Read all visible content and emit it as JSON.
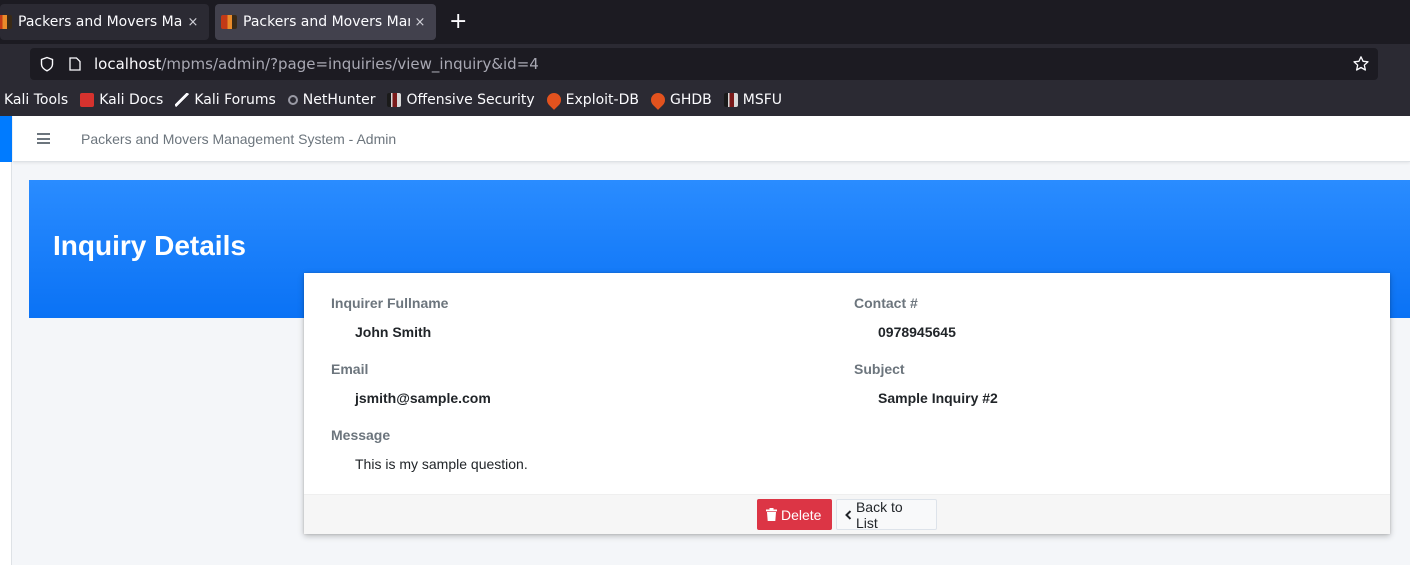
{
  "browser": {
    "tabs": [
      {
        "title": "Packers and Movers Management System",
        "close": "×"
      },
      {
        "title": "Packers and Movers Management System",
        "close": "×"
      }
    ],
    "new_tab": "+",
    "url": {
      "host": "localhost",
      "path": "/mpms/admin/?page=inquiries/view_inquiry&id=4"
    },
    "bookmarks": [
      {
        "label": "Kali Tools",
        "icon": "kali-tools-icon"
      },
      {
        "label": "Kali Docs",
        "icon": "kali-docs-icon"
      },
      {
        "label": "Kali Forums",
        "icon": "kali-forums-icon"
      },
      {
        "label": "NetHunter",
        "icon": "nethunter-icon"
      },
      {
        "label": "Offensive Security",
        "icon": "offensive-security-icon"
      },
      {
        "label": "Exploit-DB",
        "icon": "exploit-db-icon"
      },
      {
        "label": "GHDB",
        "icon": "ghdb-icon"
      },
      {
        "label": "MSFU",
        "icon": "msfu-icon"
      }
    ]
  },
  "topnav": {
    "system_title": "Packers and Movers Management System - Admin"
  },
  "page": {
    "heading": "Inquiry Details"
  },
  "inquiry": {
    "fullname_label": "Inquirer Fullname",
    "fullname": "John Smith",
    "contact_label": "Contact #",
    "contact": "0978945645",
    "email_label": "Email",
    "email": "jsmith@sample.com",
    "subject_label": "Subject",
    "subject": "Sample Inquiry #2",
    "message_label": "Message",
    "message": "This is my sample question."
  },
  "actions": {
    "delete": "Delete",
    "back": "Back to List"
  },
  "colors": {
    "primary": "#007bff",
    "danger": "#dc3545",
    "browser_dark": "#1c1b22"
  }
}
